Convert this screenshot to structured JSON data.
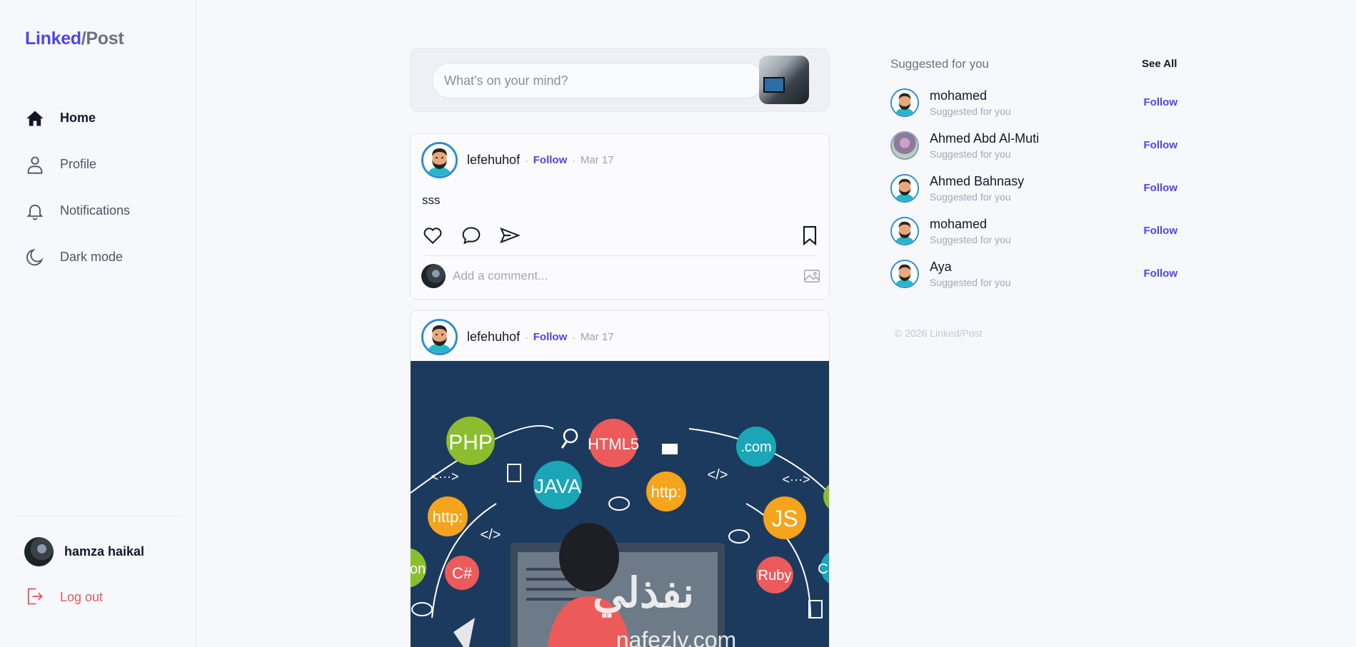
{
  "brand": {
    "part1": "Linked",
    "part2": "/Post"
  },
  "nav": {
    "items": [
      {
        "label": "Home",
        "icon": "home-icon"
      },
      {
        "label": "Profile",
        "icon": "user-icon"
      },
      {
        "label": "Notifications",
        "icon": "bell-icon"
      },
      {
        "label": "Dark mode",
        "icon": "moon-icon"
      }
    ],
    "active": "Home"
  },
  "current_user": {
    "name": "hamza haikal"
  },
  "logout_label": "Log out",
  "composer": {
    "placeholder": "What's on your mind?"
  },
  "posts": [
    {
      "author": "lefehuhof",
      "follow_label": "Follow",
      "separator": "·",
      "date": "Mar 17",
      "text": "sss",
      "comment_placeholder": "Add a comment..."
    },
    {
      "author": "lefehuhof",
      "follow_label": "Follow",
      "separator": "·",
      "date": "Mar 17",
      "image": {
        "bubbles": [
          "PHP",
          "HTML5",
          "JAVA",
          "http:",
          ".com",
          "http:",
          "JS",
          "C#",
          "Ruby",
          "on",
          "CS"
        ],
        "symbols": [
          "<···>",
          "</>",
          "</>",
          "<···>"
        ],
        "watermark_arabic": "نفذلي",
        "watermark_latin": "nafezly.com"
      }
    }
  ],
  "suggestions": {
    "title": "Suggested for you",
    "see_all": "See All",
    "items": [
      {
        "name": "mohamed",
        "subtitle": "Suggested for you",
        "follow": "Follow"
      },
      {
        "name": "Ahmed Abd Al-Muti",
        "subtitle": "Suggested for you",
        "follow": "Follow"
      },
      {
        "name": "Ahmed Bahnasy",
        "subtitle": "Suggested for you",
        "follow": "Follow"
      },
      {
        "name": "mohamed",
        "subtitle": "Suggested for you",
        "follow": "Follow"
      },
      {
        "name": "Aya",
        "subtitle": "Suggested for you",
        "follow": "Follow"
      }
    ]
  },
  "footer": {
    "copyright": "© 2026 Linked/Post"
  },
  "colors": {
    "accent": "#4f46e5",
    "danger": "#e15b5b",
    "background": "#f7f8fc"
  }
}
